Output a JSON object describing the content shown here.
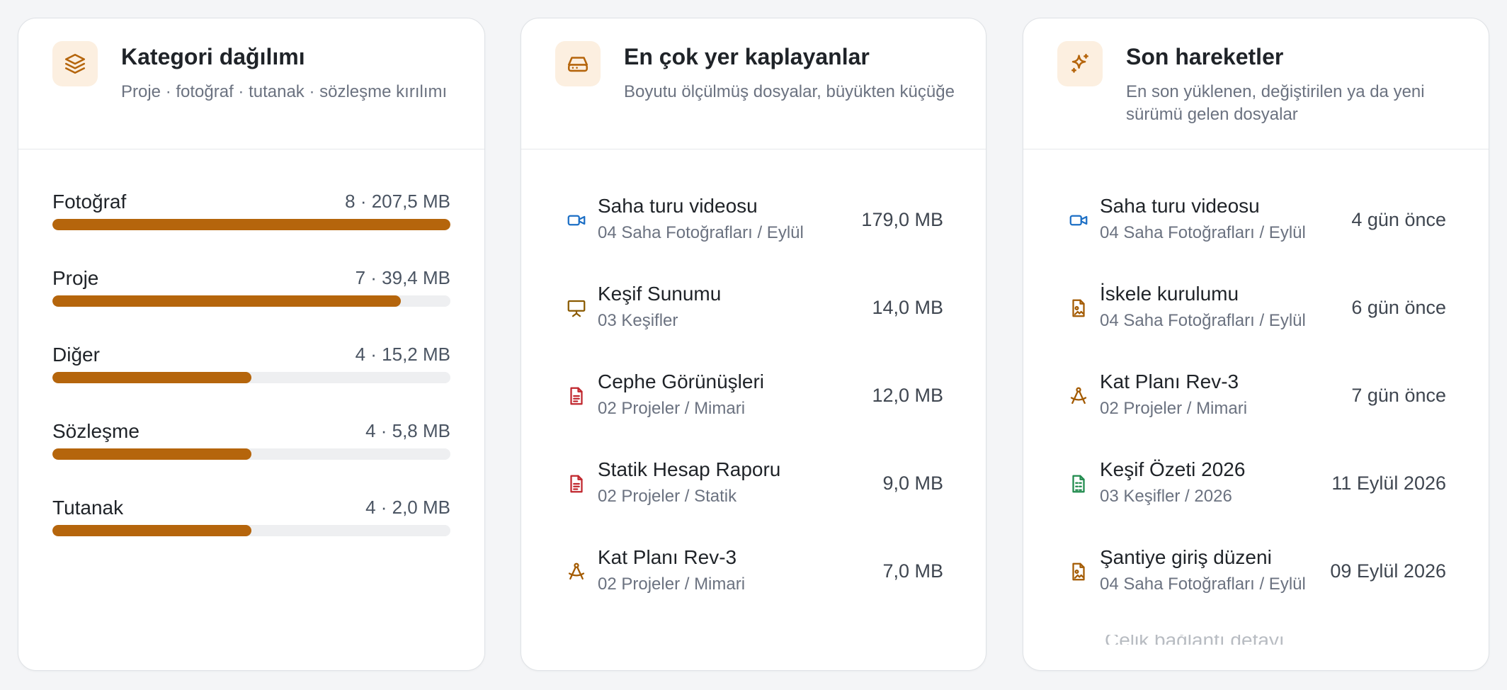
{
  "category_card": {
    "title": "Kategori dağılımı",
    "subtitle": "Proje · fotoğraf · tutanak · sözleşme kırılımı",
    "icon": "layers-icon",
    "accent_color": "#b5650c",
    "items": [
      {
        "label": "Fotoğraf",
        "value": "8 · 207,5 MB",
        "share": 1.0
      },
      {
        "label": "Proje",
        "value": "7 · 39,4 MB",
        "share": 0.875
      },
      {
        "label": "Diğer",
        "value": "4 · 15,2 MB",
        "share": 0.5
      },
      {
        "label": "Sözleşme",
        "value": "4 · 5,8 MB",
        "share": 0.5
      },
      {
        "label": "Tutanak",
        "value": "4 · 2,0 MB",
        "share": 0.5
      }
    ]
  },
  "largest_card": {
    "title": "En çok yer kaplayanlar",
    "subtitle": "Boyutu ölçülmüş dosyalar, büyükten küçüğe",
    "icon": "hard-drive-icon",
    "files": [
      {
        "name": "Saha turu videosu",
        "path": "04 Saha Fotoğrafları / Eylül",
        "size": "179,0 MB",
        "icon": "video-icon",
        "color": "#1c6fc5"
      },
      {
        "name": "Keşif Sunumu",
        "path": "03 Keşifler",
        "size": "14,0 MB",
        "icon": "presentation-icon",
        "color": "#8a5a00"
      },
      {
        "name": "Cephe Görünüşleri",
        "path": "02 Projeler / Mimari",
        "size": "12,0 MB",
        "icon": "document-icon",
        "color": "#c0262d"
      },
      {
        "name": "Statik Hesap Raporu",
        "path": "02 Projeler / Statik",
        "size": "9,0 MB",
        "icon": "document-icon",
        "color": "#c0262d"
      },
      {
        "name": "Kat Planı Rev-3",
        "path": "02 Projeler / Mimari",
        "size": "7,0 MB",
        "icon": "compass-drafting-icon",
        "color": "#a35a00"
      }
    ]
  },
  "recent_card": {
    "title": "Son hareketler",
    "subtitle": "En son yüklenen, değiştirilen ya da yeni sürümü gelen dosyalar",
    "icon": "sparkles-icon",
    "files": [
      {
        "name": "Saha turu videosu",
        "path": "04 Saha Fotoğrafları / Eylül",
        "time": "4 gün önce",
        "icon": "video-icon",
        "color": "#1c6fc5"
      },
      {
        "name": "İskele kurulumu",
        "path": "04 Saha Fotoğrafları / Eylül",
        "time": "6 gün önce",
        "icon": "image-file-icon",
        "color": "#a35a00"
      },
      {
        "name": "Kat Planı Rev-3",
        "path": "02 Projeler / Mimari",
        "time": "7 gün önce",
        "icon": "compass-drafting-icon",
        "color": "#a35a00"
      },
      {
        "name": "Keşif Özeti 2026",
        "path": "03 Keşifler / 2026",
        "time": "11 Eylül 2026",
        "icon": "spreadsheet-icon",
        "color": "#1f8a4c"
      },
      {
        "name": "Şantiye giriş düzeni",
        "path": "04 Saha Fotoğrafları / Eylül",
        "time": "09 Eylül 2026",
        "icon": "image-file-icon",
        "color": "#a35a00"
      }
    ],
    "partial_next": "Çelik bağlantı detayı"
  }
}
